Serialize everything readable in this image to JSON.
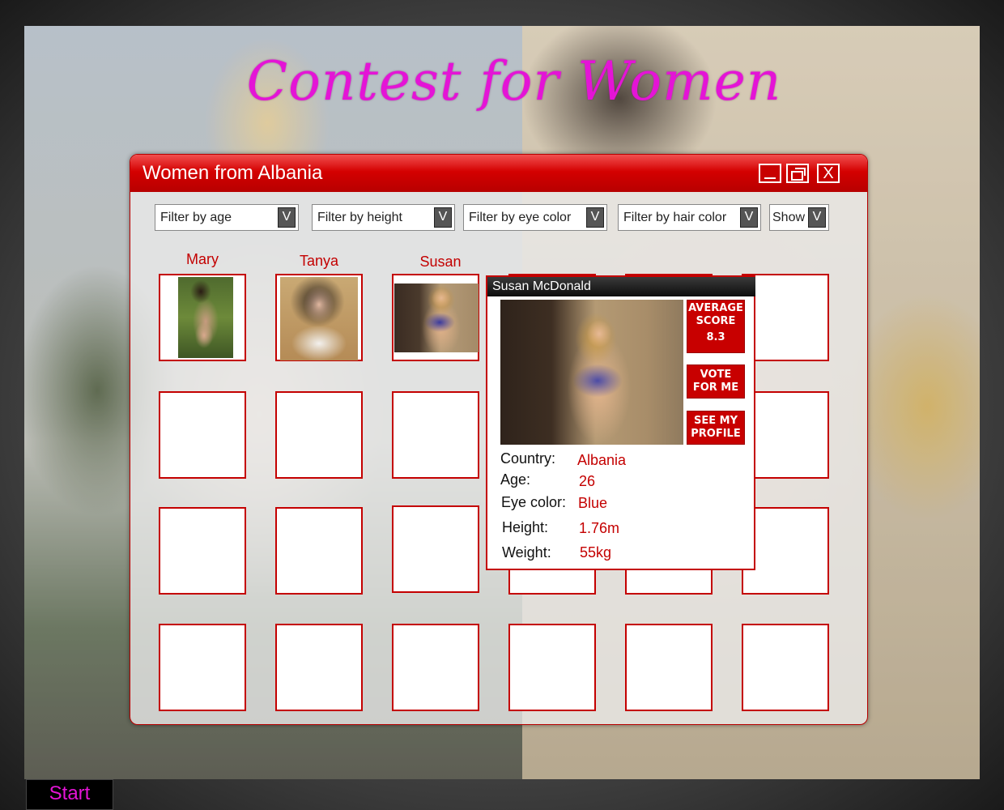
{
  "app": {
    "title": "Contest for Women"
  },
  "window": {
    "title": "Women from Albania",
    "buttons": {
      "minimize": "",
      "restore": "",
      "close": "X"
    }
  },
  "filters": [
    {
      "label": "Filter by age",
      "dropdown": "V"
    },
    {
      "label": "Filter by height",
      "dropdown": "V"
    },
    {
      "label": "Filter by eye color",
      "dropdown": "V"
    },
    {
      "label": "Filter by hair color",
      "dropdown": "V"
    },
    {
      "label": "Show",
      "dropdown": "V"
    }
  ],
  "contestants": [
    {
      "name": "Mary"
    },
    {
      "name": "Tanya"
    },
    {
      "name": "Susan"
    }
  ],
  "popup": {
    "title": "Susan McDonald",
    "score_label": "AVERAGE SCORE",
    "score_value": "8.3",
    "vote_button": "VOTE FOR ME",
    "profile_button": "SEE MY PROFILE",
    "fields": [
      {
        "label": "Country:",
        "value": "Albania"
      },
      {
        "label": "Age:",
        "value": "26"
      },
      {
        "label": "Eye color:",
        "value": "Blue"
      },
      {
        "label": "Height:",
        "value": "1.76m"
      },
      {
        "label": "Weight:",
        "value": "55kg"
      }
    ]
  },
  "taskbar": {
    "start_label": "Start"
  },
  "colors": {
    "accent": "#c80000",
    "title_magenta": "#e414d6",
    "window_bg": "#ececec"
  }
}
